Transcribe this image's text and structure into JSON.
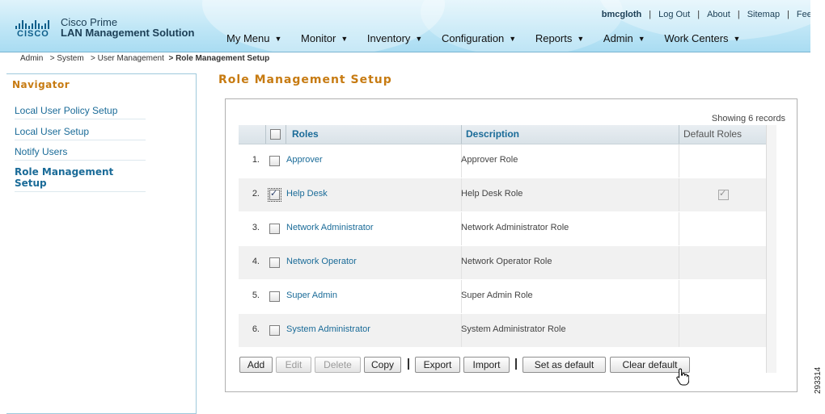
{
  "header": {
    "brand_logo_text": "CISCO",
    "product_line1": "Cisco Prime",
    "product_line2": "LAN Management Solution",
    "top_links": {
      "user": "bmcgloth",
      "logout": "Log Out",
      "about": "About",
      "sitemap": "Sitemap",
      "feedback": "Feed"
    },
    "menu": [
      {
        "label": "My Menu"
      },
      {
        "label": "Monitor"
      },
      {
        "label": "Inventory"
      },
      {
        "label": "Configuration"
      },
      {
        "label": "Reports"
      },
      {
        "label": "Admin"
      },
      {
        "label": "Work Centers"
      }
    ]
  },
  "breadcrumb": {
    "items": [
      "Admin",
      "> System",
      "> User Management",
      "> Role Management Setup"
    ]
  },
  "navigator": {
    "title": "Navigator",
    "items": [
      {
        "label": "Local User Policy Setup"
      },
      {
        "label": "Local User Setup"
      },
      {
        "label": "Notify Users"
      },
      {
        "label": "Role Management Setup",
        "selected": true
      }
    ]
  },
  "main": {
    "title": "Role Management Setup",
    "showing": "Showing 6 records",
    "columns": {
      "roles": "Roles",
      "description": "Description",
      "default": "Default Roles"
    },
    "rows": [
      {
        "num": "1.",
        "role": "Approver",
        "description": "Approver Role",
        "selected": false,
        "default": false
      },
      {
        "num": "2.",
        "role": "Help Desk",
        "description": "Help Desk Role",
        "selected": true,
        "default": true
      },
      {
        "num": "3.",
        "role": "Network Administrator",
        "description": "Network Administrator Role",
        "selected": false,
        "default": false
      },
      {
        "num": "4.",
        "role": "Network Operator",
        "description": "Network Operator Role",
        "selected": false,
        "default": false
      },
      {
        "num": "5.",
        "role": "Super Admin",
        "description": "Super Admin Role",
        "selected": false,
        "default": false
      },
      {
        "num": "6.",
        "role": "System Administrator",
        "description": "System Administrator Role",
        "selected": false,
        "default": false
      }
    ],
    "buttons": {
      "add": "Add",
      "edit": "Edit",
      "delete": "Delete",
      "copy": "Copy",
      "export": "Export",
      "import": "Import",
      "set_default": "Set as default",
      "clear_default": "Clear default"
    }
  },
  "figure_number": "293314",
  "colors": {
    "accent": "#c77b12",
    "link": "#1a6b98",
    "header_bg": "#bfe6f6"
  }
}
